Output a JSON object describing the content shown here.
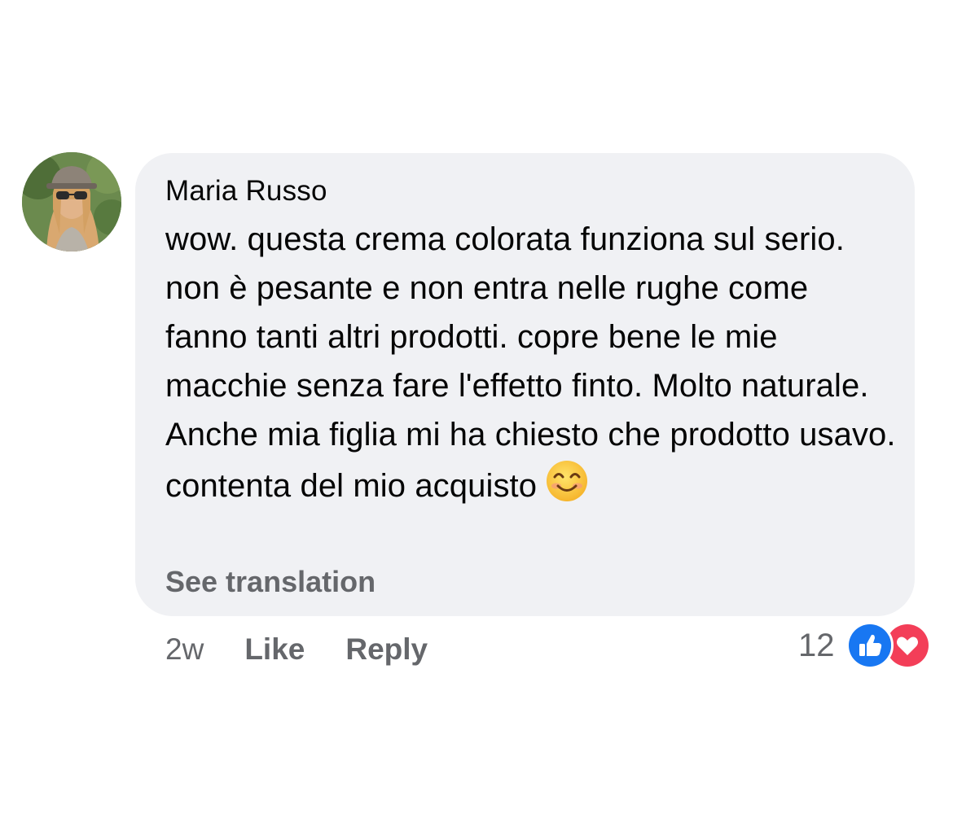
{
  "comment": {
    "author": "Maria Russo",
    "text": "wow. questa crema colorata funziona sul serio. non è pesante e non entra nelle rughe come fanno tanti altri prodotti. copre bene le mie macchie senza fare l'effetto finto. Molto naturale. Anche mia figlia mi ha chiesto che prodotto usavo. contenta del mio acquisto",
    "emoji": "smiling-face-icon",
    "see_translation": "See translation"
  },
  "actions": {
    "time": "2w",
    "like": "Like",
    "reply": "Reply"
  },
  "reactions": {
    "count": "12",
    "icons": [
      "like-reaction-icon",
      "love-reaction-icon"
    ],
    "like_color": "#1877f2",
    "love_color": "#f33e58"
  },
  "colors": {
    "bubble": "#f0f1f4",
    "secondary_text": "#65676b",
    "primary_text": "#050505"
  }
}
